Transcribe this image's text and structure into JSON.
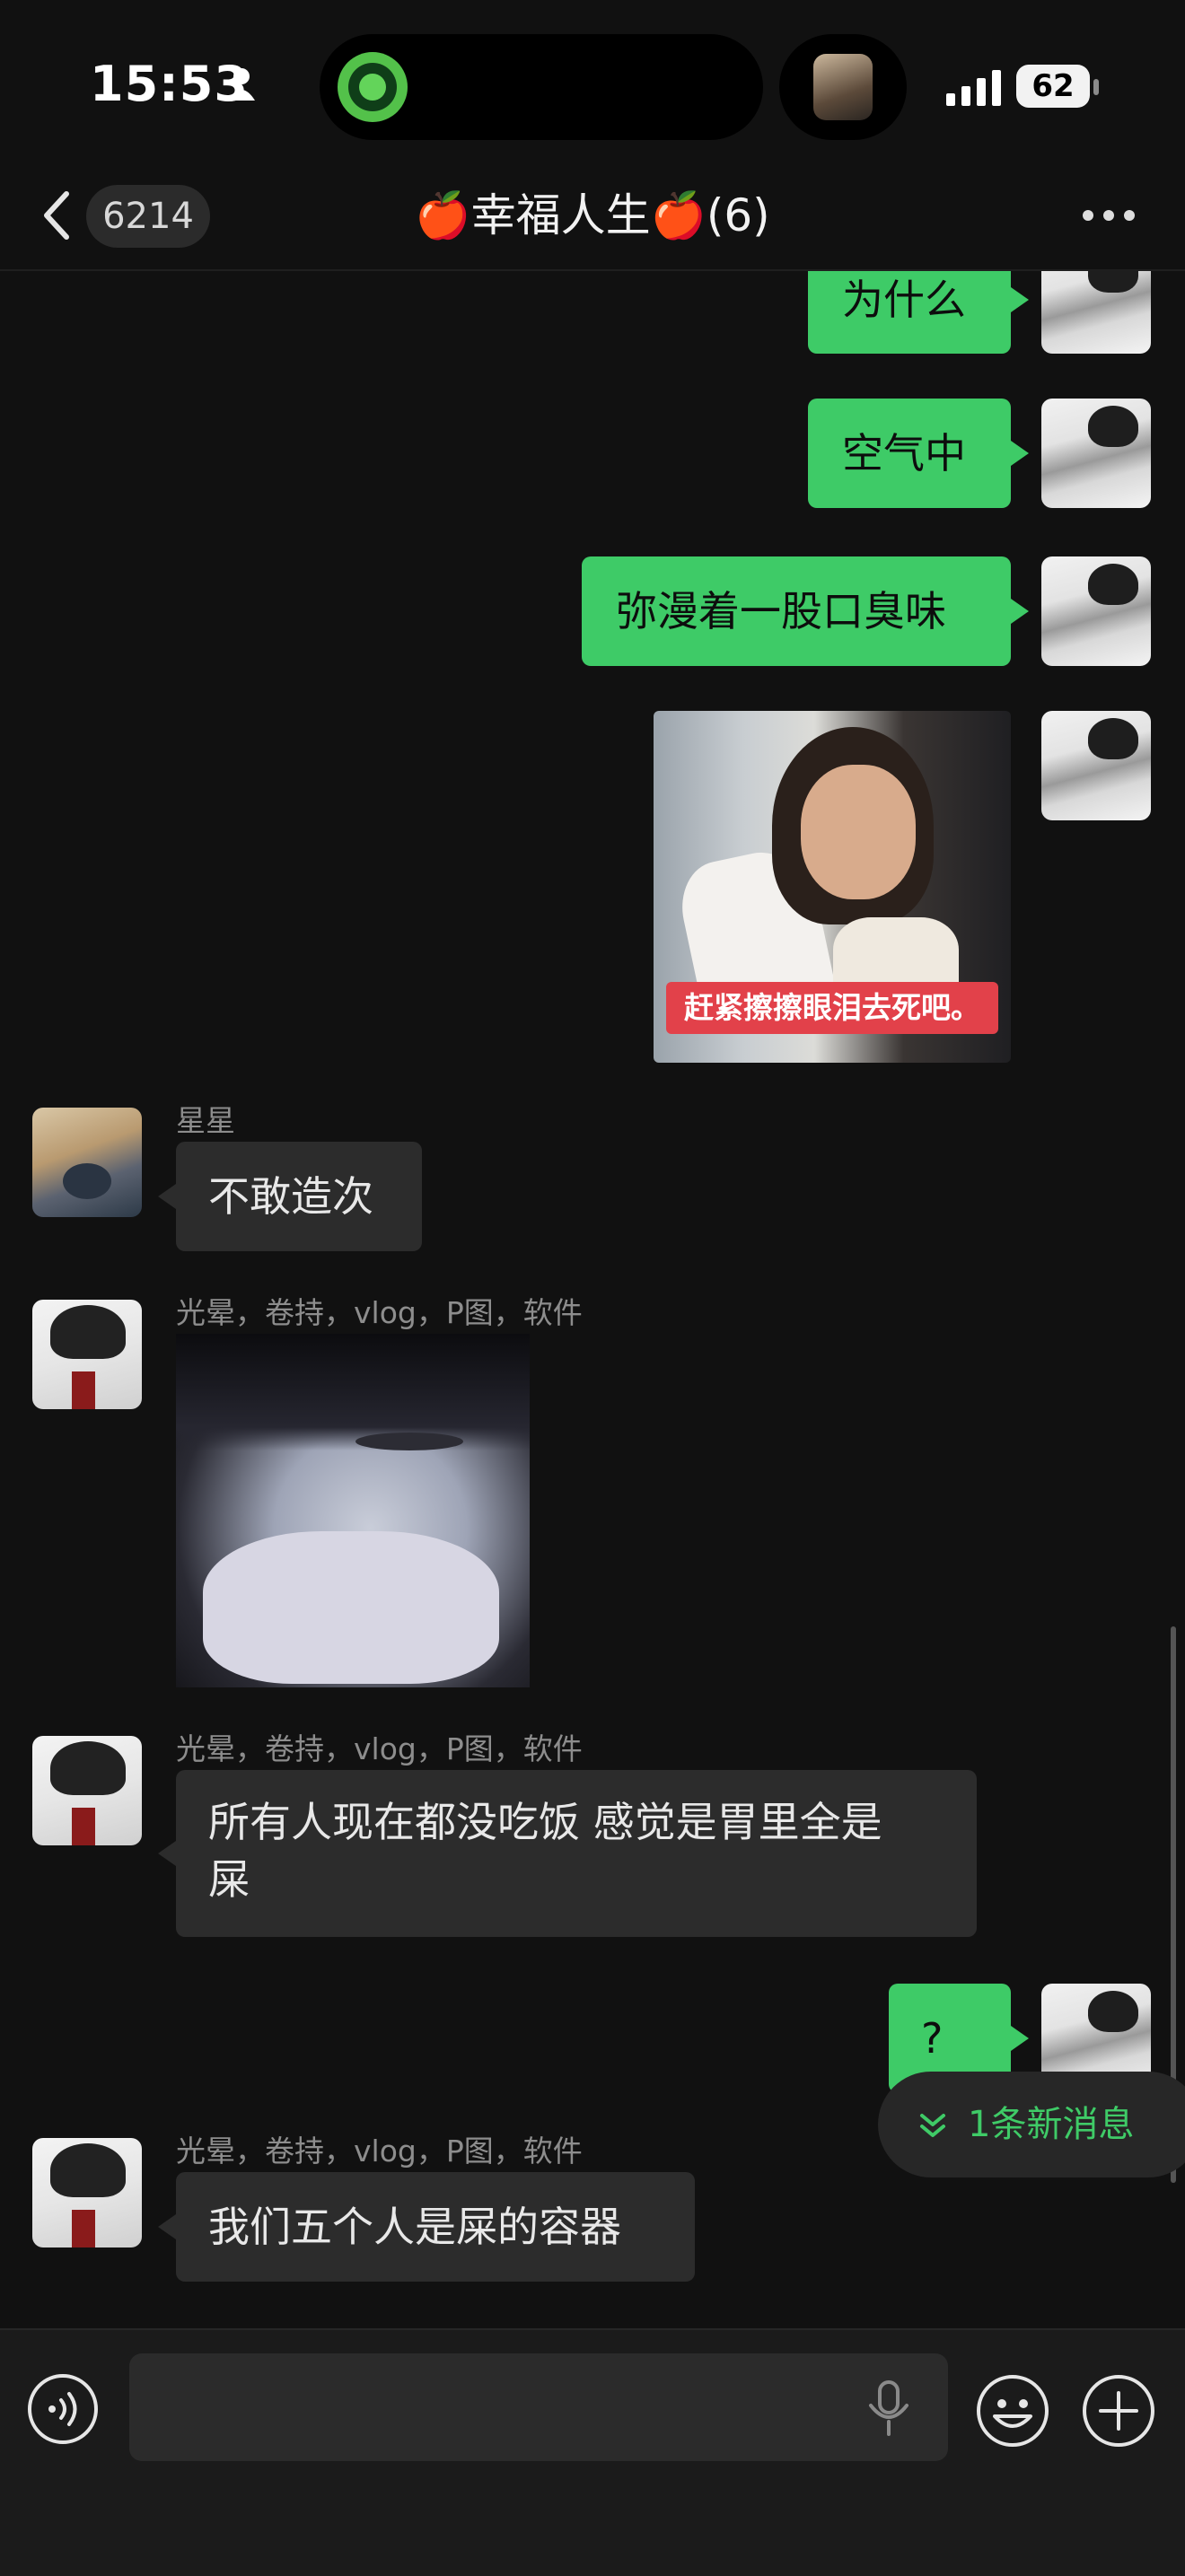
{
  "status_bar": {
    "time": "15:53",
    "battery": "62",
    "icons": [
      "person-icon",
      "signal-icon"
    ]
  },
  "header": {
    "back_badge": "6214",
    "title": "🍎幸福人生🍎(6)",
    "icons": [
      "chevron-left-icon",
      "more-icon"
    ]
  },
  "messages": [
    {
      "from": "me",
      "type": "text",
      "text": "为什么"
    },
    {
      "from": "me",
      "type": "text",
      "text": "空气中"
    },
    {
      "from": "me",
      "type": "text",
      "text": "弥漫着一股口臭味"
    },
    {
      "from": "me",
      "type": "image",
      "caption": "赶紧擦擦眼泪去死吧。"
    },
    {
      "from": "星星",
      "type": "text",
      "text": "不敢造次"
    },
    {
      "from": "光晕，卷持，vlog，P图，软件",
      "type": "image"
    },
    {
      "from": "光晕，卷持，vlog，P图，软件",
      "type": "text",
      "text_line1": "所有人现在都没吃饭 感觉是胃里全是",
      "text_line2": "屎"
    },
    {
      "from": "me",
      "type": "text",
      "text": "?"
    },
    {
      "from": "光晕，卷持，vlog，P图，软件",
      "type": "text",
      "text": "我们五个人是屎的容器"
    }
  ],
  "new_message_pill": "1条新消息",
  "input_bar": {
    "icons": [
      "voice-icon",
      "microphone-icon",
      "emoji-icon",
      "plus-icon"
    ]
  },
  "colors": {
    "background": "#111111",
    "my_bubble": "#3ecb67",
    "their_bubble": "#2c2c2c",
    "accent": "#3fcb67"
  }
}
